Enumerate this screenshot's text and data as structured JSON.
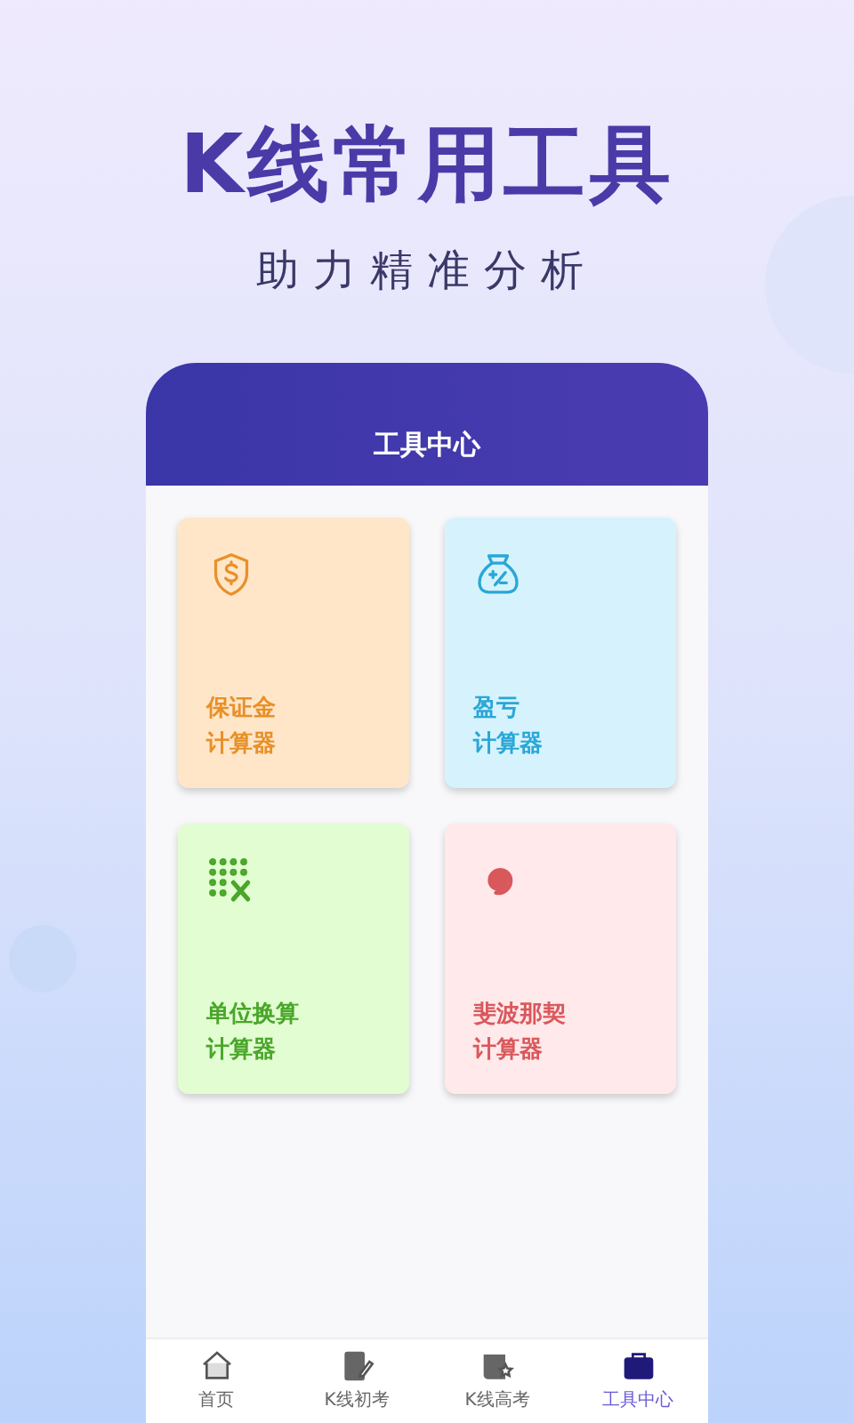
{
  "headline": "K线常用工具",
  "tagline": "助力精准分析",
  "screen": {
    "title": "工具中心",
    "cards": [
      {
        "kind": "shield",
        "title": "保证金",
        "subtitle": "计算器",
        "color": "#e8902a"
      },
      {
        "kind": "bag",
        "title": "盈亏",
        "subtitle": "计算器",
        "color": "#2aa7d6"
      },
      {
        "kind": "grid",
        "title": "单位换算",
        "subtitle": "计算器",
        "color": "#4aa62a"
      },
      {
        "kind": "spiral",
        "title": "斐波那契",
        "subtitle": "计算器",
        "color": "#d9585c"
      }
    ],
    "tabs": [
      {
        "kind": "home",
        "label": "首页",
        "selected": false
      },
      {
        "kind": "note",
        "label": "K线初考",
        "selected": false
      },
      {
        "kind": "book",
        "label": "K线高考",
        "selected": false
      },
      {
        "kind": "case",
        "label": "工具中心",
        "selected": true
      }
    ]
  }
}
